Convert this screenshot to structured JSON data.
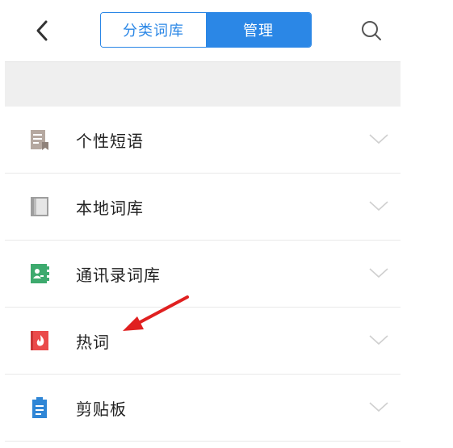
{
  "header": {
    "back_icon": "chevron-left-icon",
    "tabs": [
      {
        "label": "分类词库",
        "active": false
      },
      {
        "label": "管理",
        "active": true
      }
    ],
    "search_icon": "search-icon"
  },
  "list": {
    "items": [
      {
        "label": "个性短语",
        "icon": "note-icon",
        "icon_color": "#b5a8a0"
      },
      {
        "label": "本地词库",
        "icon": "book-icon",
        "icon_color": "#9e9e9e"
      },
      {
        "label": "通讯录词库",
        "icon": "contacts-book-icon",
        "icon_color": "#3daa6e"
      },
      {
        "label": "热词",
        "icon": "flame-icon",
        "icon_color": "#ea4a4a"
      },
      {
        "label": "剪贴板",
        "icon": "clipboard-icon",
        "icon_color": "#2f86d6"
      }
    ]
  },
  "colors": {
    "accent": "#2b87e6",
    "annotation_arrow": "#e02020"
  }
}
